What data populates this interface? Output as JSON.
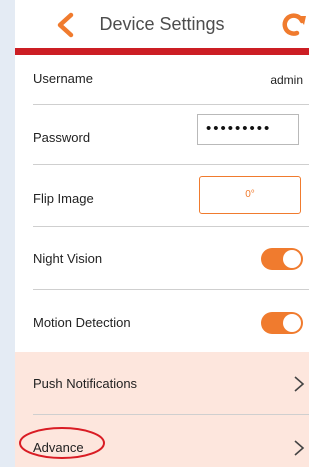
{
  "header": {
    "title": "Device Settings",
    "back_icon": "chevron-left-icon",
    "refresh_icon": "refresh-icon",
    "accent_color": "#f07b2e",
    "rule_color": "#cc1e24"
  },
  "settings": {
    "username": {
      "label": "Username",
      "value": "admin"
    },
    "password": {
      "label": "Password",
      "value": "•••••••••"
    },
    "flip_image": {
      "label": "Flip Image",
      "value": "0°"
    },
    "night_vision": {
      "label": "Night Vision",
      "enabled": true
    },
    "motion_detection": {
      "label": "Motion Detection",
      "enabled": true
    },
    "push_notifications": {
      "label": "Push Notifications"
    },
    "advance": {
      "label": "Advance"
    }
  },
  "colors": {
    "row_highlight": "#fde6dd",
    "annotation_circle": "#d91c24"
  }
}
